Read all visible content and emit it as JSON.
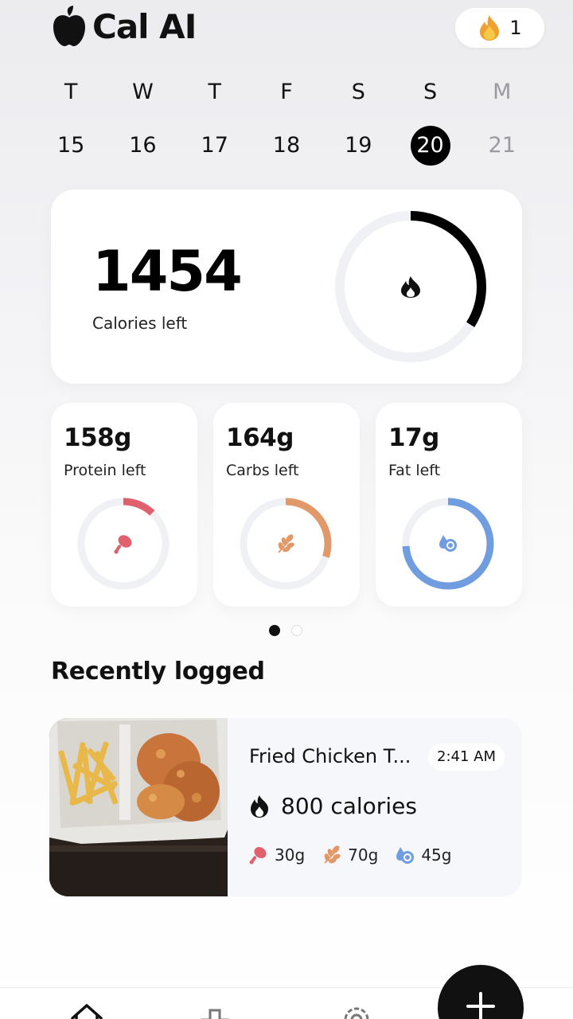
{
  "app": {
    "name": "Cal AI",
    "streak_count": "1"
  },
  "week": [
    {
      "letter": "T",
      "date": "15"
    },
    {
      "letter": "W",
      "date": "16"
    },
    {
      "letter": "T",
      "date": "17"
    },
    {
      "letter": "F",
      "date": "18"
    },
    {
      "letter": "S",
      "date": "19"
    },
    {
      "letter": "S",
      "date": "20",
      "selected": true
    },
    {
      "letter": "M",
      "date": "21",
      "future": true
    }
  ],
  "calories": {
    "value": "1454",
    "label": "Calories left",
    "progress": 0.34,
    "color": "#000000"
  },
  "macros": [
    {
      "value": "158g",
      "label": "Protein left",
      "progress": 0.12,
      "color": "#e0606e",
      "icon": "drumstick-icon"
    },
    {
      "value": "164g",
      "label": "Carbs left",
      "progress": 0.3,
      "color": "#e1996a",
      "icon": "wheat-icon"
    },
    {
      "value": "17g",
      "label": "Fat left",
      "progress": 0.74,
      "color": "#6f9de0",
      "icon": "oil-drop-icon"
    }
  ],
  "pager": {
    "count": 2,
    "active": 0
  },
  "recent": {
    "title": "Recently logged",
    "items": [
      {
        "name": "Fried Chicken T...",
        "time": "2:41 AM",
        "calories": "800 calories",
        "protein": "30g",
        "carbs": "70g",
        "fat": "45g"
      }
    ]
  },
  "nav": {
    "items": [
      "home-icon",
      "progress-icon",
      "settings-icon"
    ],
    "fab": "add-icon"
  }
}
